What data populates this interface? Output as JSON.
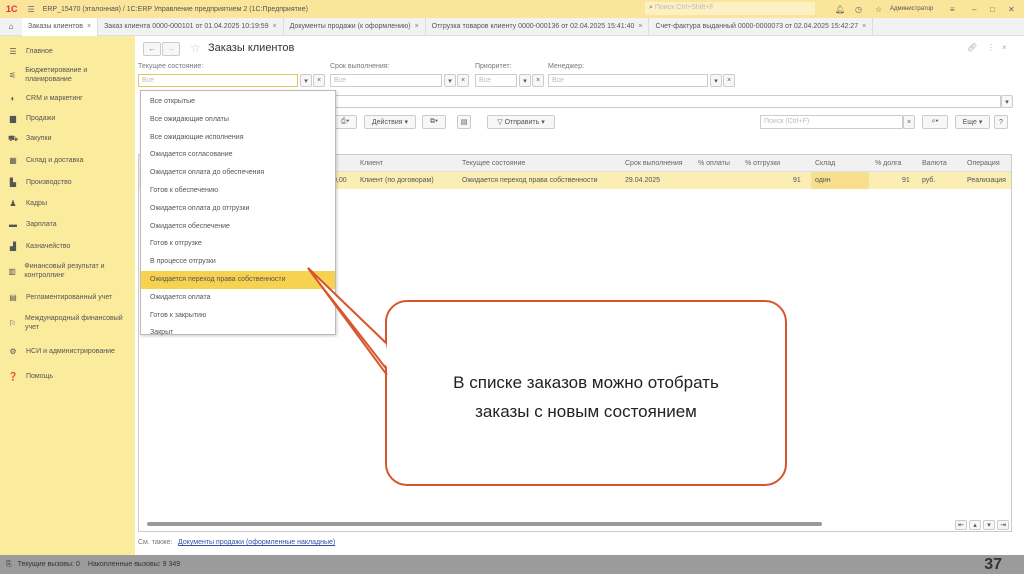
{
  "titlebar": {
    "title": "ERP_15470 (эталонная) / 1C:ERP Управление предприятием 2  (1С:Предприятие)",
    "search_placeholder": "Поиск Ctrl+Shift+F",
    "user": "Администратор"
  },
  "tabs": [
    {
      "label": "Заказы клиентов"
    },
    {
      "label": "Заказ клиента 0000-000101 от 01.04.2025 10:19:59"
    },
    {
      "label": "Документы продажи (к оформлению)"
    },
    {
      "label": "Отгрузка товаров клиенту 0000-000136 от 02.04.2025 15:41:40"
    },
    {
      "label": "Счет-фактура выданный 0000-0000073 от 02.04.2025 15:42:27"
    }
  ],
  "sidebar": {
    "items": [
      {
        "label": "Главное",
        "icon": "menu-icon"
      },
      {
        "label": "Бюджетирование и планирование",
        "icon": "chart-icon"
      },
      {
        "label": "CRM и маркетинг",
        "icon": "crm-icon"
      },
      {
        "label": "Продажи",
        "icon": "bag-icon"
      },
      {
        "label": "Закупки",
        "icon": "cart-icon"
      },
      {
        "label": "Склад и доставка",
        "icon": "warehouse-icon"
      },
      {
        "label": "Производство",
        "icon": "factory-icon"
      },
      {
        "label": "Кадры",
        "icon": "person-icon"
      },
      {
        "label": "Зарплата",
        "icon": "money-icon"
      },
      {
        "label": "Казначейство",
        "icon": "treasury-icon"
      },
      {
        "label": "Финансовый результат и контроллинг",
        "icon": "finance-icon"
      },
      {
        "label": "Регламентированный учет",
        "icon": "document-icon"
      },
      {
        "label": "Международный финансовый учет",
        "icon": "globe-icon"
      },
      {
        "label": "НСИ и администрирование",
        "icon": "gear-icon"
      },
      {
        "label": "Помощь",
        "icon": "help-icon"
      }
    ]
  },
  "form": {
    "title": "Заказы клиентов",
    "filters": {
      "state_label": "Текущее состояние:",
      "state_value": "Все",
      "deadline_label": "Срок выполнения:",
      "deadline_value": "Все",
      "priority_label": "Приоритет:",
      "priority_value": "Все",
      "manager_label": "Менеджер:",
      "manager_value": "Все"
    },
    "toolbar": {
      "actions": "Действия",
      "send": "Отправить",
      "search_placeholder": "Поиск (Ctrl+F)",
      "more": "Еще",
      "help": "?"
    },
    "dropdown": [
      "Все открытые",
      "Все ожидающие оплаты",
      "Все ожидающие исполнения",
      "Ожидается согласование",
      "Ожидается оплата до обеспечения",
      "Готов к обеспечению",
      "Ожидается оплата до отгрузки",
      "Ожидается обеспечение",
      "Готов к отгрузке",
      "В процессе отгрузки",
      "Ожидается переход права собственности",
      "Ожидается оплата",
      "Готов к закрытию",
      "Закрыт"
    ],
    "dropdown_selected": "Ожидается переход права собственности",
    "table": {
      "headers": [
        "Клиент",
        "Текущее состояние",
        "Срок выполнения",
        "% оплаты",
        "% отгрузки",
        "Склад",
        "% долга",
        "Валюта",
        "Операция"
      ],
      "rows": [
        {
          "amount": "0,00",
          "client": "Клиент (по договорам)",
          "state": "Ожидается переход права собственности",
          "deadline": "29.04.2025",
          "paid": "",
          "shipped": "91",
          "warehouse": "один",
          "debt": "91",
          "currency": "руб.",
          "operation": "Реализация"
        }
      ]
    },
    "see_also_label": "См. также:",
    "see_also_link": "Документы продажи (оформленные накладные)"
  },
  "statusbar": {
    "current": "Текущие вызовы: 0",
    "accumulated": "Накопленные вызовы: 9 349"
  },
  "callout": {
    "line1": "В списке заказов можно отобрать",
    "line2": "заказы с новым состоянием"
  },
  "slide_number": "37"
}
